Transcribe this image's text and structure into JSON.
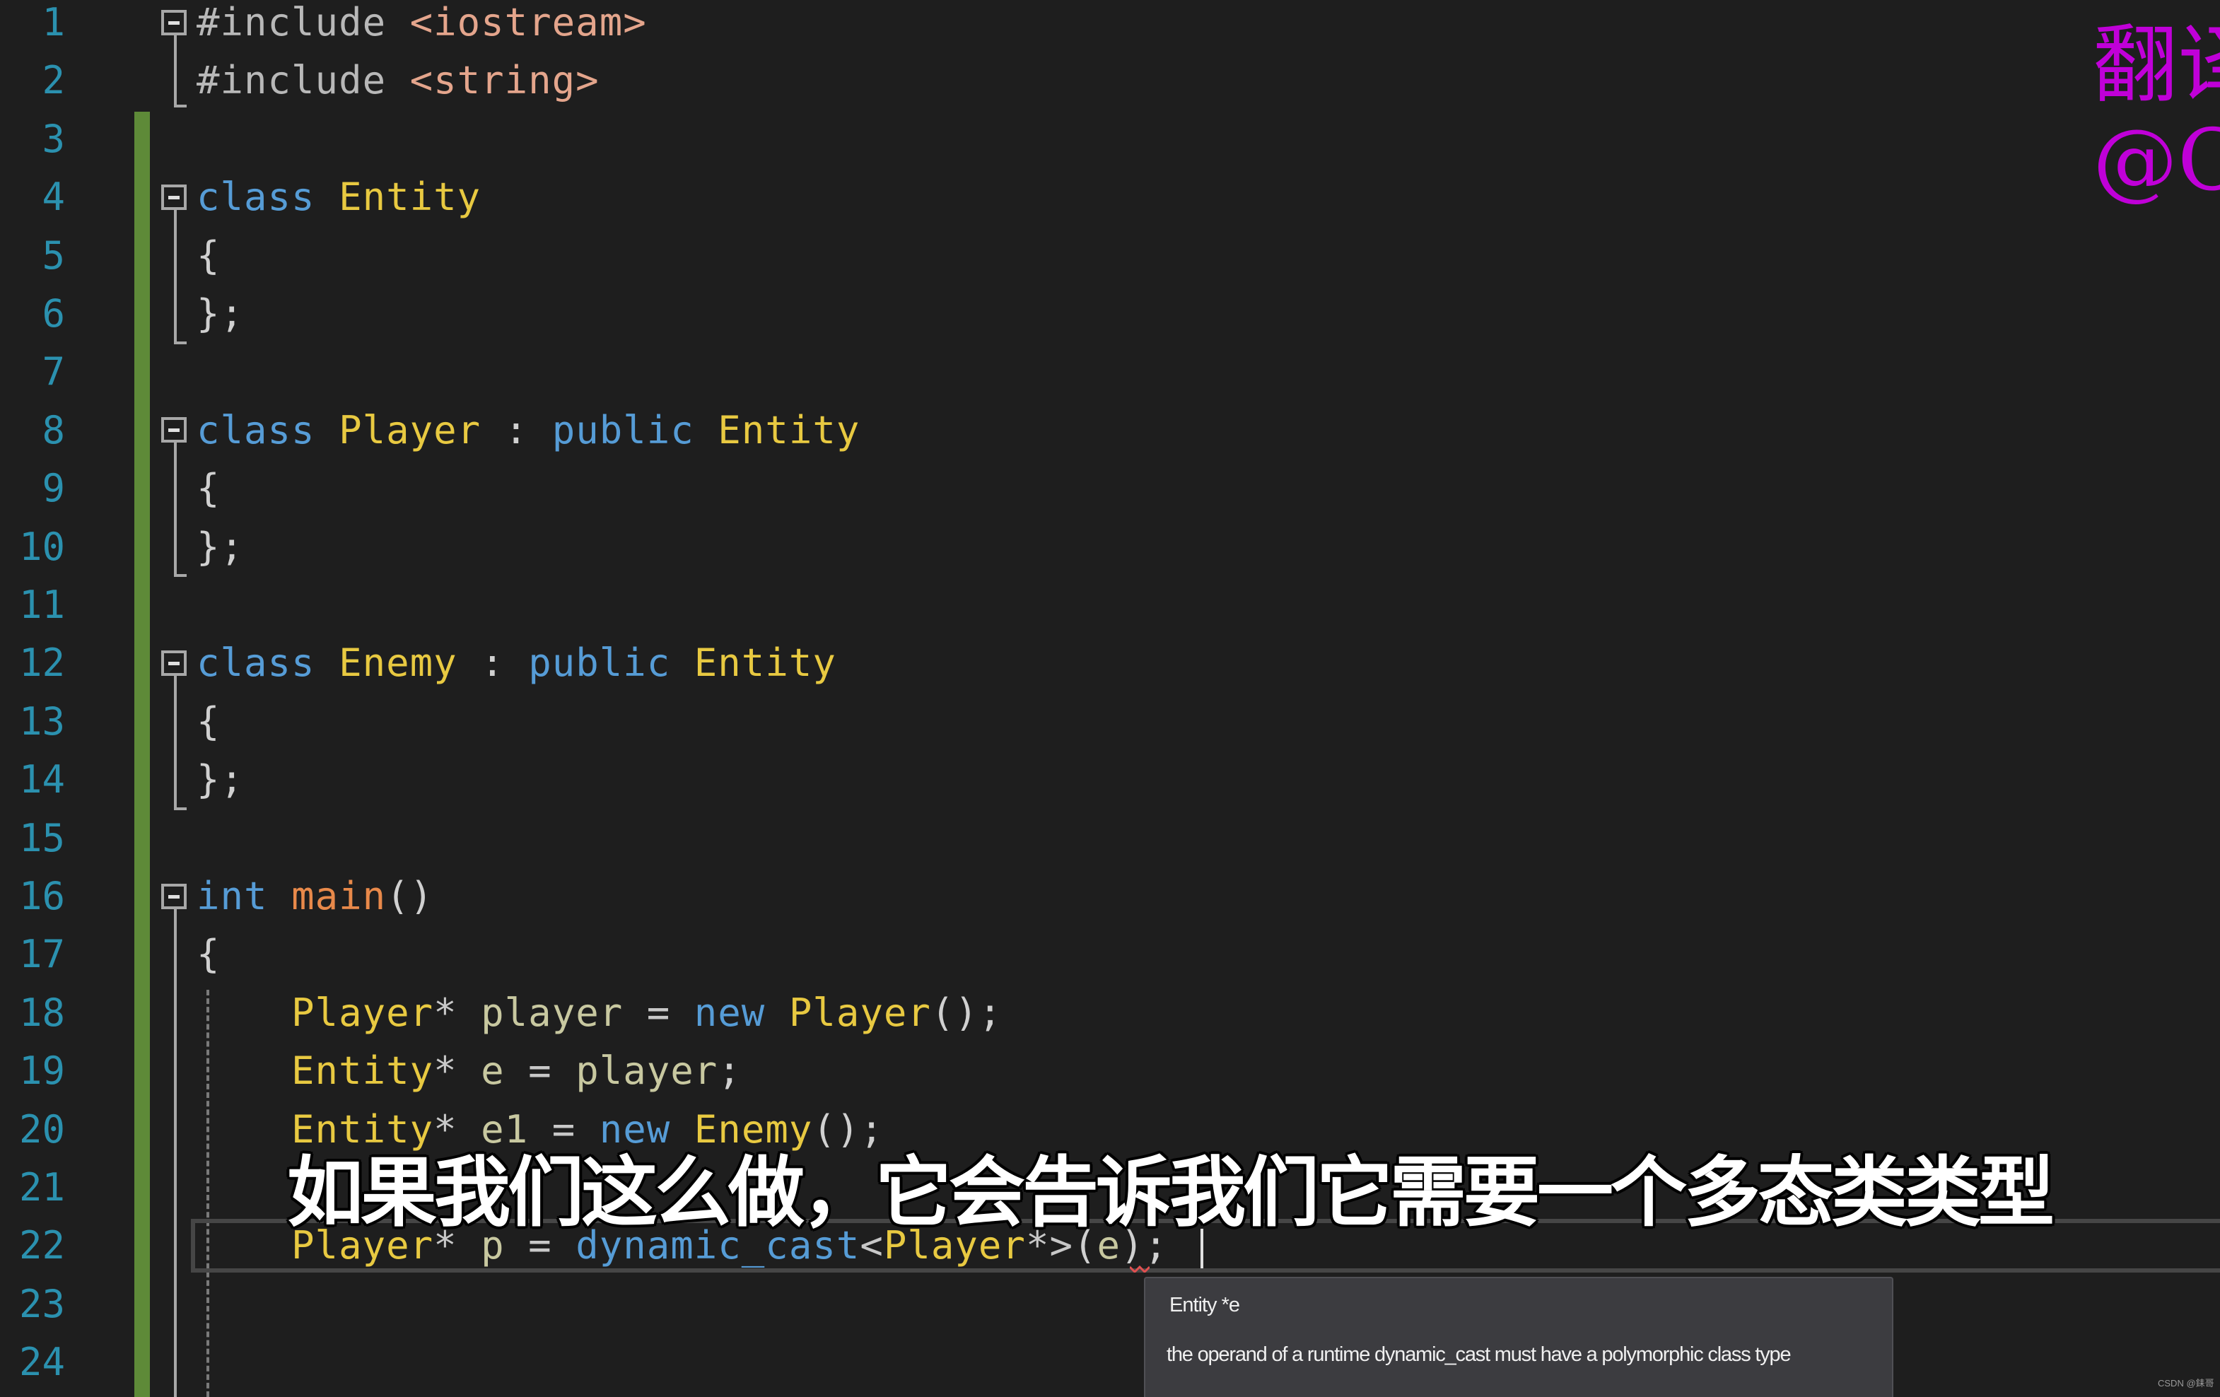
{
  "editor": {
    "language": "C++",
    "theme_colors": {
      "background": "#1e1e1e",
      "line_number": "#2b91af",
      "keyword": "#569cd6",
      "type": "#e8c941",
      "function": "#e8894a",
      "include_path": "#e4a58c",
      "variable": "#c8c8a0",
      "change_bar": "#5e8a38"
    },
    "lines": [
      {
        "n": "1",
        "tokens": [
          [
            "pp",
            "#include"
          ],
          [
            "pun",
            " "
          ],
          [
            "inc",
            "<iostream>"
          ]
        ]
      },
      {
        "n": "2",
        "tokens": [
          [
            "pp",
            "#include"
          ],
          [
            "pun",
            " "
          ],
          [
            "inc",
            "<string>"
          ]
        ]
      },
      {
        "n": "3",
        "tokens": []
      },
      {
        "n": "4",
        "tokens": [
          [
            "kw",
            "class"
          ],
          [
            "pun",
            " "
          ],
          [
            "ty",
            "Entity"
          ]
        ]
      },
      {
        "n": "5",
        "tokens": [
          [
            "pun",
            "{"
          ]
        ]
      },
      {
        "n": "6",
        "tokens": [
          [
            "pun",
            "};"
          ]
        ]
      },
      {
        "n": "7",
        "tokens": []
      },
      {
        "n": "8",
        "tokens": [
          [
            "kw",
            "class"
          ],
          [
            "pun",
            " "
          ],
          [
            "ty",
            "Player"
          ],
          [
            "pun",
            " : "
          ],
          [
            "kw",
            "public"
          ],
          [
            "pun",
            " "
          ],
          [
            "ty",
            "Entity"
          ]
        ]
      },
      {
        "n": "9",
        "tokens": [
          [
            "pun",
            "{"
          ]
        ]
      },
      {
        "n": "10",
        "tokens": [
          [
            "pun",
            "};"
          ]
        ]
      },
      {
        "n": "11",
        "tokens": []
      },
      {
        "n": "12",
        "tokens": [
          [
            "kw",
            "class"
          ],
          [
            "pun",
            " "
          ],
          [
            "ty",
            "Enemy"
          ],
          [
            "pun",
            " : "
          ],
          [
            "kw",
            "public"
          ],
          [
            "pun",
            " "
          ],
          [
            "ty",
            "Entity"
          ]
        ]
      },
      {
        "n": "13",
        "tokens": [
          [
            "pun",
            "{"
          ]
        ]
      },
      {
        "n": "14",
        "tokens": [
          [
            "pun",
            "};"
          ]
        ]
      },
      {
        "n": "15",
        "tokens": []
      },
      {
        "n": "16",
        "tokens": [
          [
            "kw",
            "int"
          ],
          [
            "pun",
            " "
          ],
          [
            "fn",
            "main"
          ],
          [
            "pun",
            "()"
          ]
        ]
      },
      {
        "n": "17",
        "tokens": [
          [
            "pun",
            "{"
          ]
        ]
      },
      {
        "n": "18",
        "tokens": [
          [
            "pun",
            "    "
          ],
          [
            "ty",
            "Player"
          ],
          [
            "op",
            "*"
          ],
          [
            "pun",
            " "
          ],
          [
            "var",
            "player"
          ],
          [
            "op",
            " = "
          ],
          [
            "kw",
            "new"
          ],
          [
            "pun",
            " "
          ],
          [
            "ty",
            "Player"
          ],
          [
            "pun",
            "();"
          ]
        ]
      },
      {
        "n": "19",
        "tokens": [
          [
            "pun",
            "    "
          ],
          [
            "ty",
            "Entity"
          ],
          [
            "op",
            "*"
          ],
          [
            "pun",
            " "
          ],
          [
            "var",
            "e"
          ],
          [
            "op",
            " = "
          ],
          [
            "var",
            "player"
          ],
          [
            "pun",
            ";"
          ]
        ]
      },
      {
        "n": "20",
        "tokens": [
          [
            "pun",
            "    "
          ],
          [
            "ty",
            "Entity"
          ],
          [
            "op",
            "*"
          ],
          [
            "pun",
            " "
          ],
          [
            "var",
            "e1"
          ],
          [
            "op",
            " = "
          ],
          [
            "kw",
            "new"
          ],
          [
            "pun",
            " "
          ],
          [
            "ty",
            "Enemy"
          ],
          [
            "pun",
            "();"
          ]
        ]
      },
      {
        "n": "21",
        "tokens": []
      },
      {
        "n": "22",
        "tokens": [
          [
            "pun",
            "    "
          ],
          [
            "ty",
            "Player"
          ],
          [
            "op",
            "*"
          ],
          [
            "pun",
            " "
          ],
          [
            "var",
            "p"
          ],
          [
            "op",
            " = "
          ],
          [
            "kw",
            "dynamic_cast"
          ],
          [
            "op",
            "<"
          ],
          [
            "ty",
            "Player"
          ],
          [
            "op",
            "*>"
          ],
          [
            "pun",
            "("
          ],
          [
            "var",
            "e"
          ],
          [
            "pun",
            ");"
          ]
        ]
      },
      {
        "n": "23",
        "tokens": []
      },
      {
        "n": "24",
        "tokens": []
      }
    ],
    "current_line": "22"
  },
  "tooltip": {
    "signature": "Entity *e",
    "message": "the operand of a runtime dynamic_cast must have a polymorphic class type"
  },
  "subtitle": {
    "text": "如果我们这么做，它会告诉我们它需要一个多态类类型"
  },
  "watermark": {
    "line1": "翻译",
    "line2": "@Ch",
    "color": "#c000d8"
  },
  "credit": "CSDN @銇哥"
}
